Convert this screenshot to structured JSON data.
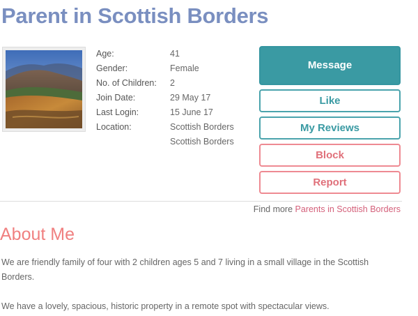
{
  "page": {
    "title": "Parent in Scottish Borders"
  },
  "profile": {
    "details": [
      {
        "label": "Age:",
        "value": "41"
      },
      {
        "label": "Gender:",
        "value": "Female"
      },
      {
        "label": "No. of Children:",
        "value": "2"
      },
      {
        "label": "Join Date:",
        "value": "29 May 17"
      },
      {
        "label": "Last Login:",
        "value": "15 June 17"
      },
      {
        "label": "Location:",
        "value": "Scottish Borders"
      },
      {
        "label": "",
        "value": "Scottish Borders"
      }
    ]
  },
  "actions": {
    "message": "Message",
    "like": "Like",
    "reviews": "My Reviews",
    "block": "Block",
    "report": "Report"
  },
  "find_more": {
    "prefix": "Find more ",
    "link": "Parents in Scottish Borders"
  },
  "about": {
    "heading": "About Me",
    "paragraphs": [
      "We are friendly family of four with 2 children ages 5 and 7 living in a small village in the Scottish Borders.",
      "We have a lovely, spacious, historic property in a remote spot with spectacular views."
    ]
  },
  "colors": {
    "title": "#7a8fc0",
    "teal": "#3a9aa3",
    "pink": "#e0707a",
    "about_heading": "#f08080"
  }
}
